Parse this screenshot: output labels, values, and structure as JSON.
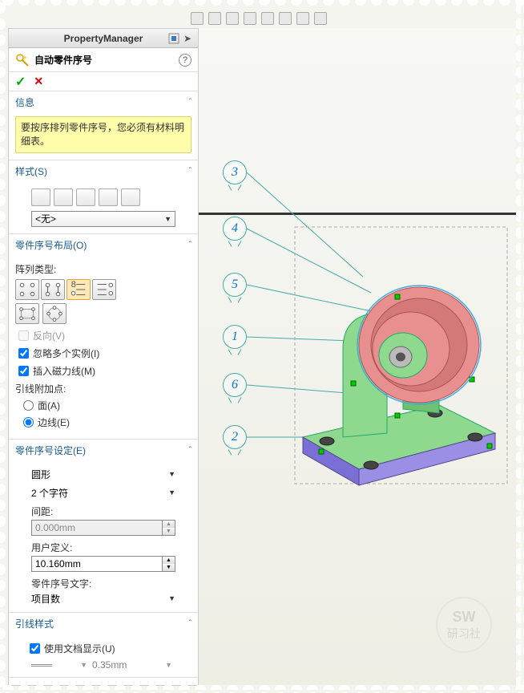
{
  "header": {
    "title": "PropertyManager",
    "feature_name": "自动零件序号",
    "help_icon": "?"
  },
  "actions": {
    "ok": "✓",
    "cancel": "✕"
  },
  "sections": {
    "info": {
      "title": "信息",
      "message": "要按序排列零件序号，您必须有材料明细表。"
    },
    "style": {
      "title": "样式(S)",
      "selected": "<无>"
    },
    "layout": {
      "title": "零件序号布局(O)",
      "array_label": "阵列类型:",
      "reverse_label": "反向(V)",
      "reverse_checked": false,
      "ignore_label": "忽略多个实例(I)",
      "ignore_checked": true,
      "magnetic_label": "插入磁力线(M)",
      "magnetic_checked": true,
      "attach_label": "引线附加点:",
      "face_label": "面(A)",
      "edge_label": "边线(E)",
      "attach_selected": "edge"
    },
    "settings": {
      "title": "零件序号设定(E)",
      "shape": "圆形",
      "chars": "2 个字符",
      "spacing_label": "间距:",
      "spacing_value": "0.000mm",
      "user_label": "用户定义:",
      "user_value": "10.160mm",
      "text_label": "零件序号文字:",
      "text_value": "项目数"
    },
    "leader": {
      "title": "引线样式",
      "use_doc_label": "使用文档显示(U)",
      "use_doc_checked": true,
      "thickness": "0.35mm"
    }
  },
  "balloons": [
    "3",
    "4",
    "5",
    "1",
    "6",
    "2"
  ],
  "watermark": {
    "top": "SW",
    "bottom": "研习社"
  }
}
